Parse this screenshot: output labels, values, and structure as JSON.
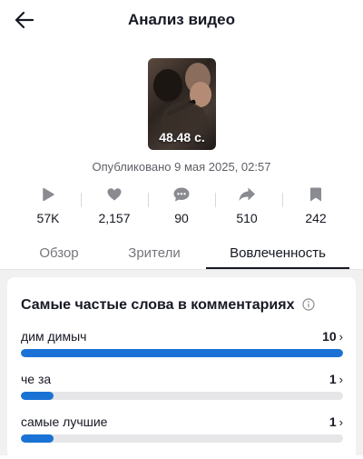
{
  "header": {
    "title": "Анализ видео",
    "back_icon": "arrow-left-icon"
  },
  "video": {
    "duration": "48.48 с.",
    "published": "Опубликовано 9 мая 2025, 02:57"
  },
  "stats": [
    {
      "icon": "play-icon",
      "value": "57K"
    },
    {
      "icon": "heart-icon",
      "value": "2,157"
    },
    {
      "icon": "comment-icon",
      "value": "90"
    },
    {
      "icon": "share-icon",
      "value": "510"
    },
    {
      "icon": "bookmark-icon",
      "value": "242"
    }
  ],
  "tabs": [
    {
      "label": "Обзор",
      "active": false
    },
    {
      "label": "Зрители",
      "active": false
    },
    {
      "label": "Вовлеченность",
      "active": true
    }
  ],
  "words_card": {
    "title": "Самые частые слова в комментариях",
    "info_icon": "info-icon",
    "chevron": "›",
    "items": [
      {
        "word": "дим димыч",
        "count": "10",
        "fraction": 1.0
      },
      {
        "word": "че за",
        "count": "1",
        "fraction": 0.1
      },
      {
        "word": "самые лучшие",
        "count": "1",
        "fraction": 0.1
      }
    ]
  },
  "colors": {
    "bar": "#1a73d4",
    "track": "#e6e6e8",
    "icon_gray": "#8a8b91",
    "text": "#161823"
  }
}
